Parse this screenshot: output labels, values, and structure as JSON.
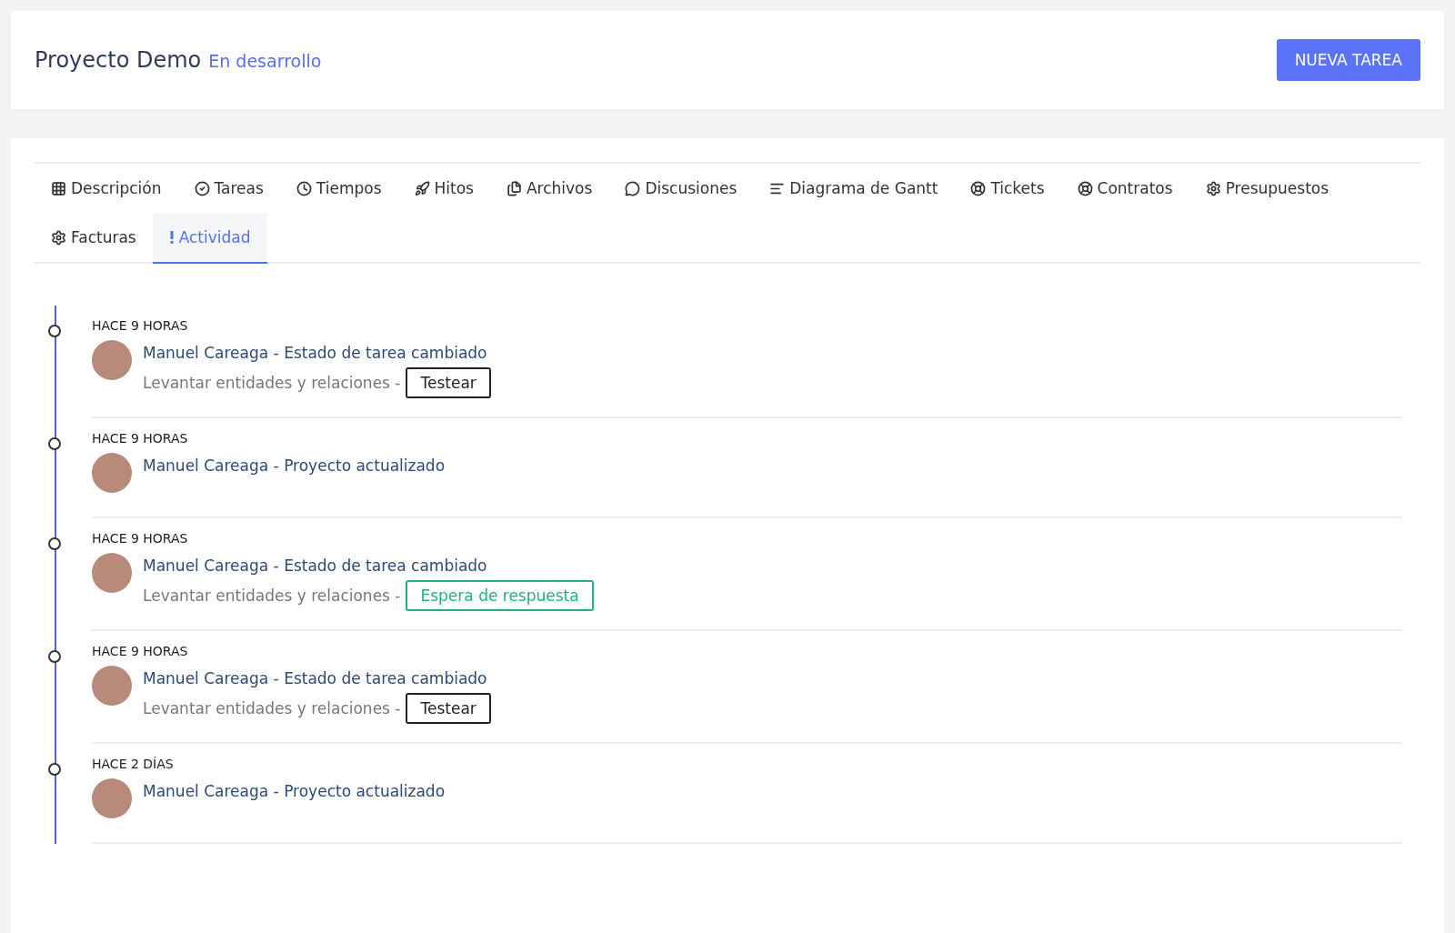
{
  "header": {
    "title": "Proyecto Demo",
    "status": "En desarrollo",
    "button": "NUEVA TAREA"
  },
  "tabs": [
    {
      "label": "Descripción",
      "selected": false
    },
    {
      "label": "Tareas",
      "selected": false
    },
    {
      "label": "Tiempos",
      "selected": false
    },
    {
      "label": "Hitos",
      "selected": false
    },
    {
      "label": "Archivos",
      "selected": false
    },
    {
      "label": "Discusiones",
      "selected": false
    },
    {
      "label": "Diagrama de Gantt",
      "selected": false
    },
    {
      "label": "Tickets",
      "selected": false
    },
    {
      "label": "Contratos",
      "selected": false
    },
    {
      "label": "Presupuestos",
      "selected": false
    },
    {
      "label": "Facturas",
      "selected": false
    },
    {
      "label": "Actividad",
      "selected": true
    }
  ],
  "activity": [
    {
      "time": "HACE 9 HORAS",
      "title": "Manuel Careaga - Estado de tarea cambiado",
      "detail": "Levantar entidades y relaciones -",
      "tag": {
        "label": "Testear",
        "color": "#222222"
      }
    },
    {
      "time": "HACE 9 HORAS",
      "title": "Manuel Careaga - Proyecto actualizado"
    },
    {
      "time": "HACE 9 HORAS",
      "title": "Manuel Careaga - Estado de tarea cambiado",
      "detail": "Levantar entidades y relaciones -",
      "tag": {
        "label": "Espera de respuesta",
        "color": "#1db27e"
      }
    },
    {
      "time": "HACE 9 HORAS",
      "title": "Manuel Careaga - Estado de tarea cambiado",
      "detail": "Levantar entidades y relaciones -",
      "tag": {
        "label": "Testear",
        "color": "#222222"
      }
    },
    {
      "time": "HACE 2 DÍAS",
      "title": "Manuel Careaga - Proyecto actualizado"
    }
  ]
}
